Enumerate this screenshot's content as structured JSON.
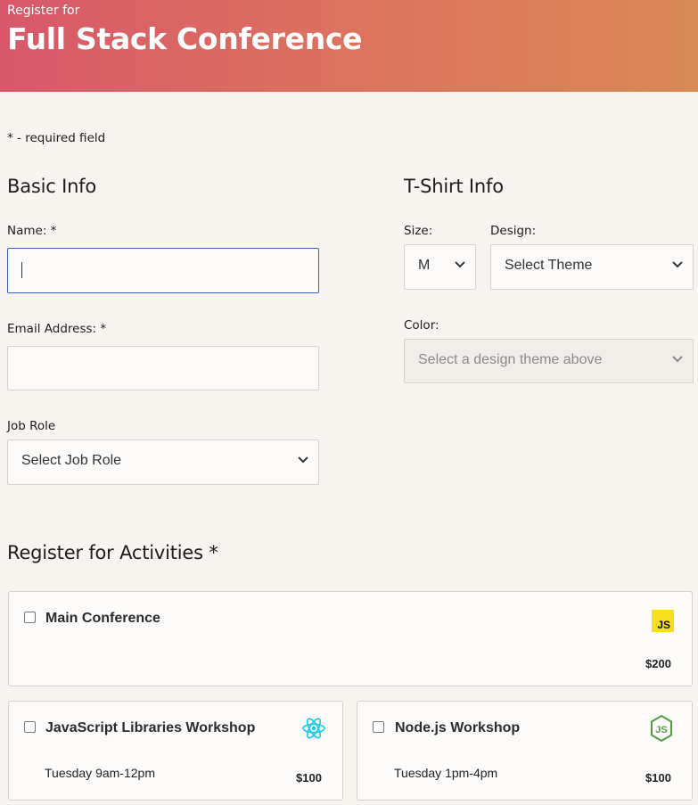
{
  "header": {
    "pre_title": "Register for",
    "title": "Full Stack Conference"
  },
  "required_note": "* - required field",
  "basic_info": {
    "heading": "Basic Info",
    "name_label": "Name: *",
    "name_value": "",
    "email_label": "Email Address: *",
    "email_value": "",
    "job_label": "Job Role",
    "job_selected": "Select Job Role"
  },
  "tshirt": {
    "heading": "T-Shirt Info",
    "size_label": "Size:",
    "size_selected": "M",
    "design_label": "Design:",
    "design_selected": "Select Theme",
    "color_label": "Color:",
    "color_selected": "Select a design theme above"
  },
  "activities": {
    "heading": "Register for Activities",
    "required_mark": "*",
    "items": [
      {
        "name": "Main Conference",
        "time": "",
        "price": "$200",
        "icon": "js-icon"
      },
      {
        "name": "JavaScript Libraries Workshop",
        "time": "Tuesday 9am-12pm",
        "price": "$100",
        "icon": "react-icon"
      },
      {
        "name": "Node.js Workshop",
        "time": "Tuesday 1pm-4pm",
        "price": "$100",
        "icon": "nodejs-icon"
      }
    ]
  },
  "colors": {
    "header_start": "#d8586a",
    "header_end": "#d98a55",
    "background": "#f8f4ef",
    "focus_border": "#3b5fbd",
    "js_yellow": "#f7df1e",
    "react_cyan": "#14c8ea",
    "node_green": "#539e43"
  }
}
